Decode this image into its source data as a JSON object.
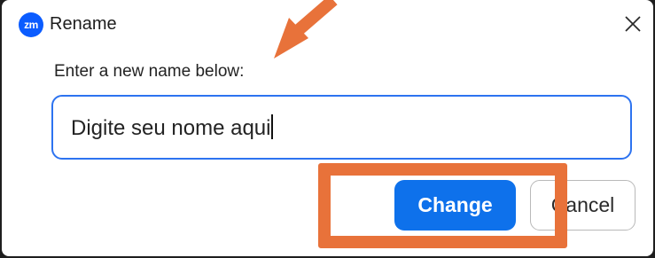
{
  "dialog": {
    "app_logo_text": "zm",
    "title": "Rename",
    "close_icon": "close-icon",
    "prompt": "Enter a new name below:",
    "input_value": "Digite seu nome aqui",
    "change_label": "Change",
    "cancel_label": "Cancel"
  },
  "annotations": {
    "highlight_color": "#e8723a",
    "arrow_color": "#e8723a"
  },
  "colors": {
    "primary": "#0e71eb",
    "input_border": "#2d73f0",
    "brand": "#0b5cff"
  }
}
